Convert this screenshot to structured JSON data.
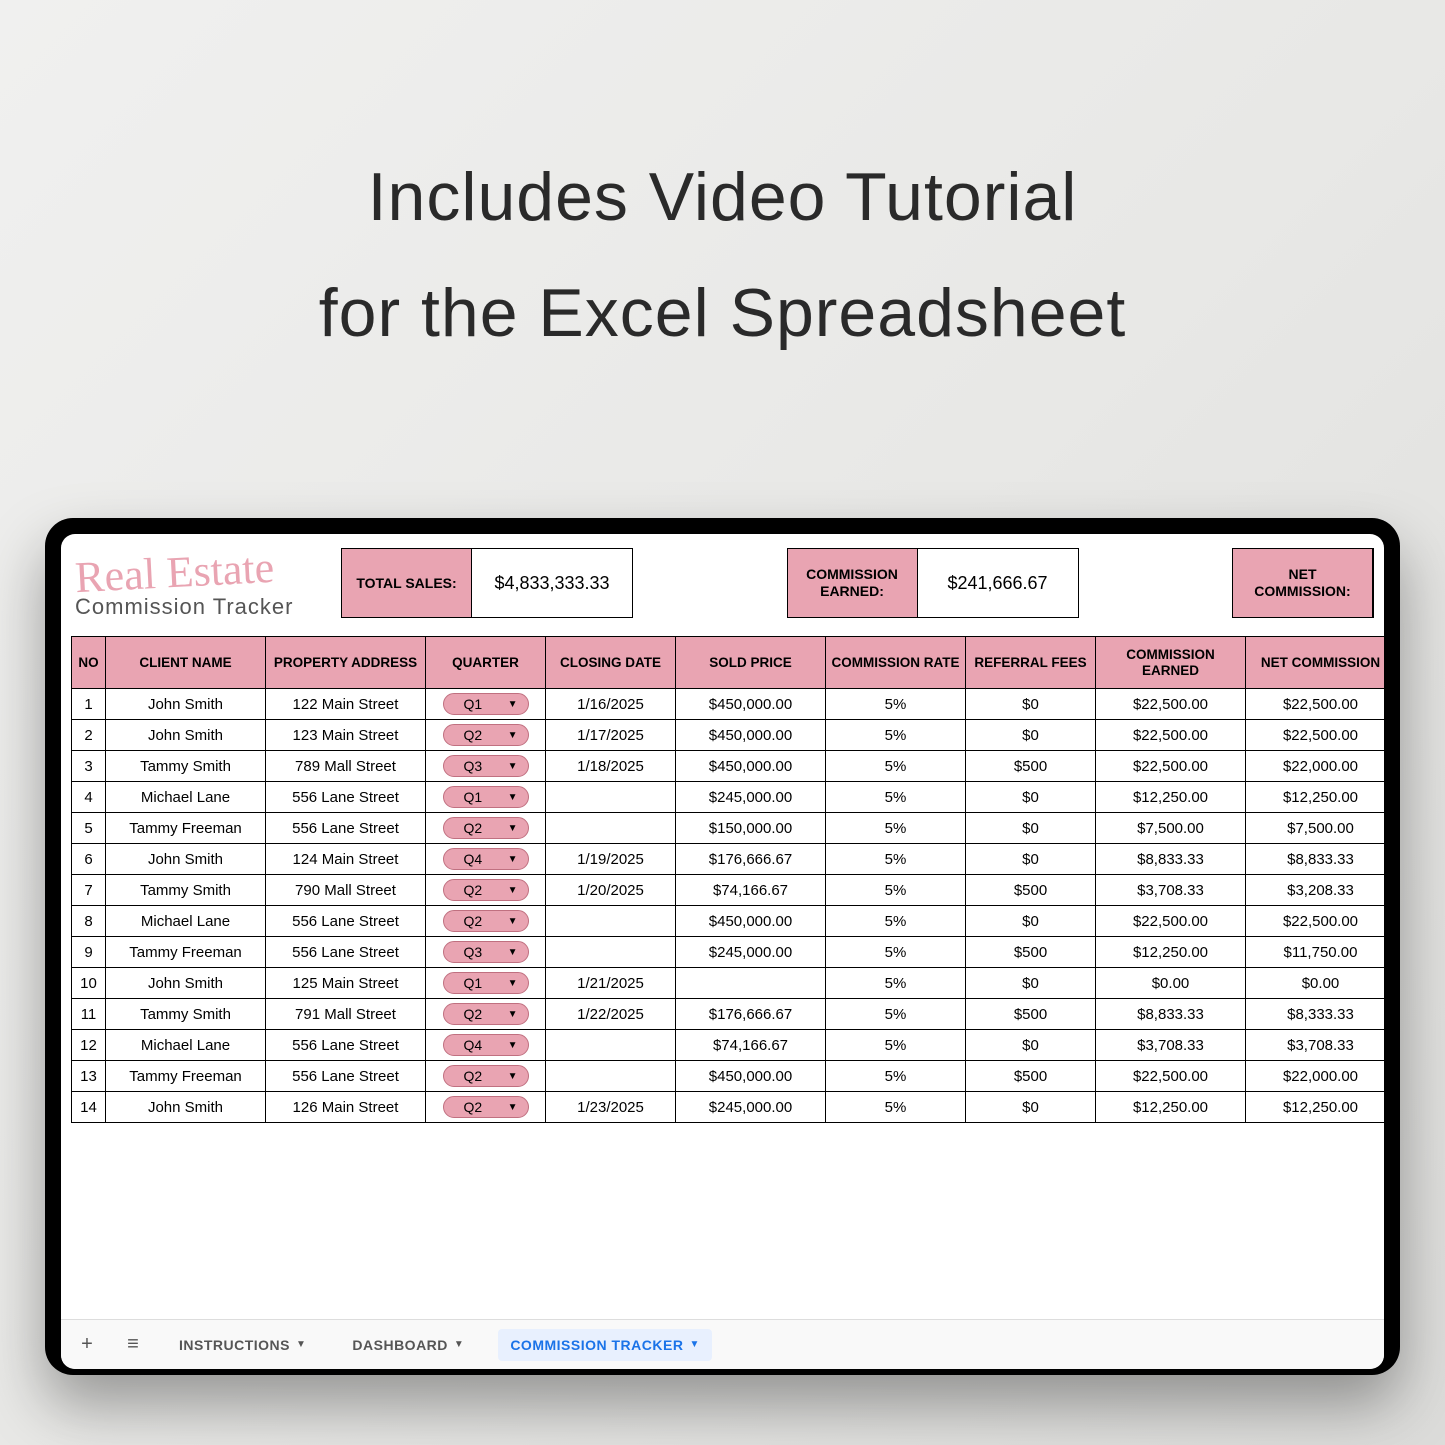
{
  "hero": {
    "line1": "Includes Video Tutorial",
    "line2": "for the Excel Spreadsheet"
  },
  "brand": {
    "script": "Real Estate",
    "sub": "Commission Tracker"
  },
  "stats": {
    "total_sales_label": "TOTAL SALES:",
    "total_sales_value": "$4,833,333.33",
    "commission_earned_label": "COMMISSION EARNED:",
    "commission_earned_value": "$241,666.67",
    "net_commission_label": "NET COMMISSION:"
  },
  "columns": {
    "no": "NO",
    "client": "CLIENT NAME",
    "address": "PROPERTY ADDRESS",
    "quarter": "QUARTER",
    "date": "CLOSING DATE",
    "price": "SOLD PRICE",
    "rate": "COMMISSION RATE",
    "ref": "REFERRAL FEES",
    "earn": "COMMISSION EARNED",
    "net": "NET COMMISSION"
  },
  "rows": [
    {
      "no": "1",
      "client": "John Smith",
      "address": "122 Main Street",
      "quarter": "Q1",
      "date": "1/16/2025",
      "price": "$450,000.00",
      "rate": "5%",
      "ref": "$0",
      "earn": "$22,500.00",
      "net": "$22,500.00"
    },
    {
      "no": "2",
      "client": "John Smith",
      "address": "123 Main Street",
      "quarter": "Q2",
      "date": "1/17/2025",
      "price": "$450,000.00",
      "rate": "5%",
      "ref": "$0",
      "earn": "$22,500.00",
      "net": "$22,500.00"
    },
    {
      "no": "3",
      "client": "Tammy Smith",
      "address": "789 Mall Street",
      "quarter": "Q3",
      "date": "1/18/2025",
      "price": "$450,000.00",
      "rate": "5%",
      "ref": "$500",
      "earn": "$22,500.00",
      "net": "$22,000.00"
    },
    {
      "no": "4",
      "client": "Michael Lane",
      "address": "556 Lane Street",
      "quarter": "Q1",
      "date": "",
      "price": "$245,000.00",
      "rate": "5%",
      "ref": "$0",
      "earn": "$12,250.00",
      "net": "$12,250.00"
    },
    {
      "no": "5",
      "client": "Tammy Freeman",
      "address": "556 Lane Street",
      "quarter": "Q2",
      "date": "",
      "price": "$150,000.00",
      "rate": "5%",
      "ref": "$0",
      "earn": "$7,500.00",
      "net": "$7,500.00"
    },
    {
      "no": "6",
      "client": "John Smith",
      "address": "124 Main Street",
      "quarter": "Q4",
      "date": "1/19/2025",
      "price": "$176,666.67",
      "rate": "5%",
      "ref": "$0",
      "earn": "$8,833.33",
      "net": "$8,833.33"
    },
    {
      "no": "7",
      "client": "Tammy Smith",
      "address": "790 Mall Street",
      "quarter": "Q2",
      "date": "1/20/2025",
      "price": "$74,166.67",
      "rate": "5%",
      "ref": "$500",
      "earn": "$3,708.33",
      "net": "$3,208.33"
    },
    {
      "no": "8",
      "client": "Michael Lane",
      "address": "556 Lane Street",
      "quarter": "Q2",
      "date": "",
      "price": "$450,000.00",
      "rate": "5%",
      "ref": "$0",
      "earn": "$22,500.00",
      "net": "$22,500.00"
    },
    {
      "no": "9",
      "client": "Tammy Freeman",
      "address": "556 Lane Street",
      "quarter": "Q3",
      "date": "",
      "price": "$245,000.00",
      "rate": "5%",
      "ref": "$500",
      "earn": "$12,250.00",
      "net": "$11,750.00"
    },
    {
      "no": "10",
      "client": "John Smith",
      "address": "125 Main Street",
      "quarter": "Q1",
      "date": "1/21/2025",
      "price": "",
      "rate": "5%",
      "ref": "$0",
      "earn": "$0.00",
      "net": "$0.00"
    },
    {
      "no": "11",
      "client": "Tammy Smith",
      "address": "791 Mall Street",
      "quarter": "Q2",
      "date": "1/22/2025",
      "price": "$176,666.67",
      "rate": "5%",
      "ref": "$500",
      "earn": "$8,833.33",
      "net": "$8,333.33"
    },
    {
      "no": "12",
      "client": "Michael Lane",
      "address": "556 Lane Street",
      "quarter": "Q4",
      "date": "",
      "price": "$74,166.67",
      "rate": "5%",
      "ref": "$0",
      "earn": "$3,708.33",
      "net": "$3,708.33"
    },
    {
      "no": "13",
      "client": "Tammy Freeman",
      "address": "556 Lane Street",
      "quarter": "Q2",
      "date": "",
      "price": "$450,000.00",
      "rate": "5%",
      "ref": "$500",
      "earn": "$22,500.00",
      "net": "$22,000.00"
    },
    {
      "no": "14",
      "client": "John Smith",
      "address": "126 Main Street",
      "quarter": "Q2",
      "date": "1/23/2025",
      "price": "$245,000.00",
      "rate": "5%",
      "ref": "$0",
      "earn": "$12,250.00",
      "net": "$12,250.00"
    }
  ],
  "tabs": {
    "add": "+",
    "all": "≡",
    "instructions": "INSTRUCTIONS",
    "dashboard": "DASHBOARD",
    "tracker": "COMMISSION TRACKER"
  }
}
